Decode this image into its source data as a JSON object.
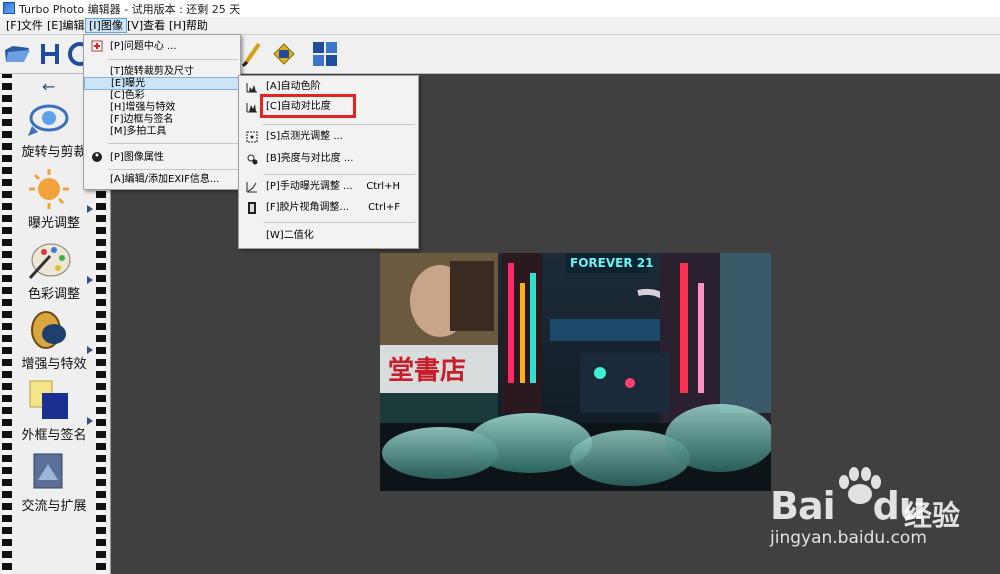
{
  "window": {
    "title": "Turbo Photo 编辑器 - 试用版本 : 还剩 25 天"
  },
  "menubar": {
    "items": [
      "[F]文件",
      "[E]编辑",
      "[I]图像",
      "[V]查看",
      "[H]帮助"
    ],
    "active_index": 2
  },
  "sidebar": {
    "items": [
      {
        "label": "旋转与剪裁",
        "icon": "rotate-crop-icon"
      },
      {
        "label": "曝光调整",
        "icon": "exposure-sun-icon"
      },
      {
        "label": "色彩调整",
        "icon": "color-palette-icon"
      },
      {
        "label": "增强与特效",
        "icon": "enhance-lens-icon"
      },
      {
        "label": "外框与签名",
        "icon": "frame-signature-icon"
      },
      {
        "label": "交流与扩展",
        "icon": "share-extend-icon"
      }
    ]
  },
  "image_menu": {
    "items": [
      {
        "label": "[P]问题中心 ..."
      },
      {
        "label": "[T]旋转裁剪及尺寸"
      },
      {
        "label": "[E]曝光",
        "highlighted": true
      },
      {
        "label": "[C]色彩"
      },
      {
        "label": "[H]增强与特效"
      },
      {
        "label": "[F]边框与签名"
      },
      {
        "label": "[M]多拍工具"
      },
      {
        "label": "[P]图像属性"
      },
      {
        "label": "[A]编辑/添加EXIF信息..."
      }
    ]
  },
  "exposure_submenu": {
    "items": [
      {
        "label": "[A]自动色阶",
        "shortcut": ""
      },
      {
        "label": "[C]自动对比度",
        "shortcut": ""
      },
      {
        "label": "[S]点测光调整 ...",
        "shortcut": ""
      },
      {
        "label": "[B]亮度与对比度 ...",
        "shortcut": ""
      },
      {
        "label": "[P]手动曝光调整 ...",
        "shortcut": "Ctrl+H"
      },
      {
        "label": "[F]胶片视角调整...",
        "shortcut": "Ctrl+F"
      },
      {
        "label": "[W]二值化",
        "shortcut": ""
      }
    ]
  },
  "photo": {
    "sign_text": "FOREVER 21",
    "shop_text": "堂書店"
  },
  "watermark": {
    "brand": "Bai",
    "brand_tail": "du",
    "brand_cn": "经验",
    "url": "jingyan.baidu.com"
  },
  "colors": {
    "accent_highlight": "#cce4f7",
    "callout_red": "#e8231f",
    "workspace": "#404040"
  }
}
